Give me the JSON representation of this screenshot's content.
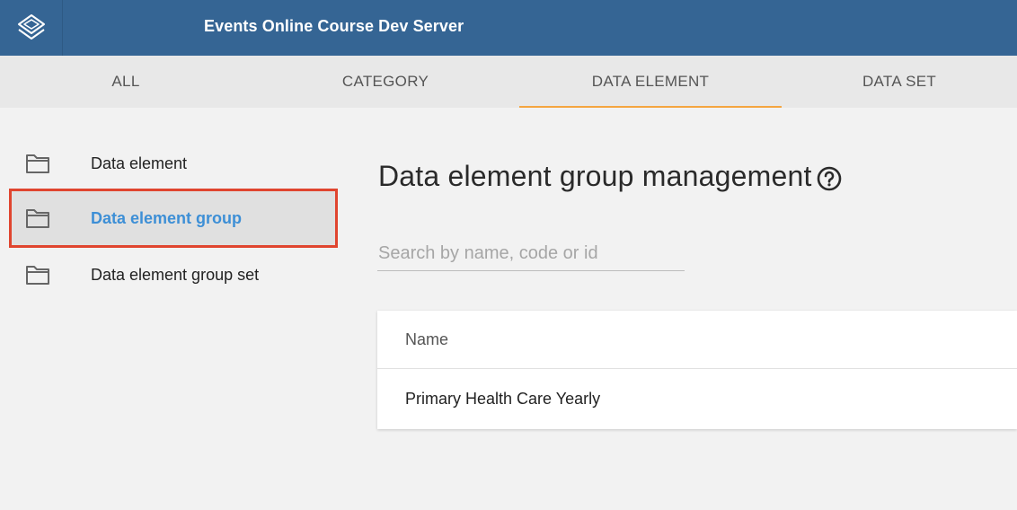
{
  "header": {
    "title": "Events Online Course Dev Server",
    "logo_icon": "dhis2-layers-icon"
  },
  "tabs": [
    {
      "label": "ALL",
      "active": false
    },
    {
      "label": "CATEGORY",
      "active": false
    },
    {
      "label": "DATA ELEMENT",
      "active": true
    },
    {
      "label": "DATA SET",
      "active": false
    }
  ],
  "sidebar": {
    "items": [
      {
        "label": "Data element",
        "icon": "folder-icon",
        "selected": false
      },
      {
        "label": "Data element group",
        "icon": "folder-icon",
        "selected": true
      },
      {
        "label": "Data element group set",
        "icon": "folder-icon",
        "selected": false
      }
    ]
  },
  "main": {
    "title": "Data element group management",
    "help_icon": "help-circle-icon",
    "search": {
      "placeholder": "Search by name, code or id",
      "value": ""
    },
    "table": {
      "columns": [
        "Name"
      ],
      "rows": [
        [
          "Primary Health Care Yearly"
        ]
      ]
    }
  },
  "colors": {
    "header_bg": "#356594",
    "tab_bar_bg": "#e8e8e8",
    "tab_active_underline": "#f4a540",
    "selected_text": "#3d8fd6",
    "highlight_border": "#e0452f",
    "page_bg": "#f2f2f2"
  }
}
